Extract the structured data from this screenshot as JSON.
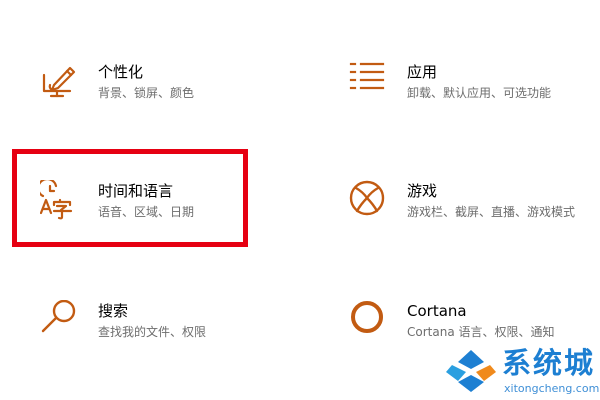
{
  "settings": {
    "tiles": [
      {
        "title": "个性化",
        "description": "背景、锁屏、颜色",
        "icon": "personalization-icon"
      },
      {
        "title": "应用",
        "description": "卸载、默认应用、可选功能",
        "icon": "apps-list-icon"
      },
      {
        "title": "时间和语言",
        "description": "语音、区域、日期",
        "icon": "time-language-icon"
      },
      {
        "title": "游戏",
        "description": "游戏栏、截屏、直播、游戏模式",
        "icon": "xbox-icon"
      },
      {
        "title": "搜索",
        "description": "查找我的文件、权限",
        "icon": "search-icon"
      },
      {
        "title": "Cortana",
        "description": "Cortana 语言、权限、通知",
        "icon": "cortana-icon"
      }
    ],
    "icon_color": "#c25b12",
    "highlight_color": "#e60012"
  },
  "watermark": {
    "name": "系统城",
    "domain": "xitongcheng.com",
    "colors": [
      "#1d7fd2",
      "#2a9fe0",
      "#f08a1c"
    ]
  }
}
